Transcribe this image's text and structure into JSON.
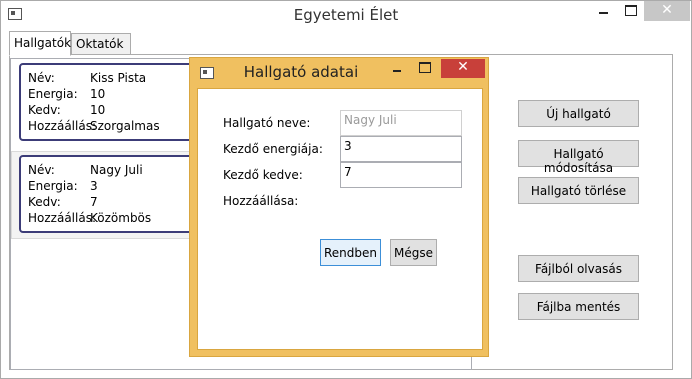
{
  "window": {
    "title": "Egyetemi Élet",
    "close_glyph": "✕"
  },
  "tabs": [
    {
      "label": "Hallgatók",
      "active": true
    },
    {
      "label": "Oktatók",
      "active": false
    }
  ],
  "students": [
    {
      "fields": [
        {
          "label": "Név:",
          "value": "Kiss Pista"
        },
        {
          "label": "Energia:",
          "value": "10"
        },
        {
          "label": "Kedv:",
          "value": "10"
        },
        {
          "label": "Hozzáállás:",
          "value": "Szorgalmas"
        }
      ]
    },
    {
      "fields": [
        {
          "label": "Név:",
          "value": "Nagy Juli"
        },
        {
          "label": "Energia:",
          "value": "3"
        },
        {
          "label": "Kedv:",
          "value": "7"
        },
        {
          "label": "Hozzáállás:",
          "value": "Közömbös"
        }
      ]
    }
  ],
  "side_buttons": {
    "new": "Új hallgató",
    "modify": "Hallgató módosítása",
    "delete": "Hallgató törlése",
    "load": "Fájlból olvasás",
    "save": "Fájlba mentés"
  },
  "dialog": {
    "title": "Hallgató adatai",
    "close_glyph": "✕",
    "name_label": "Hallgató neve:",
    "name_value": "Nagy Juli",
    "energy_label": "Kezdő energiája:",
    "energy_value": "3",
    "mood_label": "Kezdő kedve:",
    "mood_value": "7",
    "attitude_label": "Hozzáállása:",
    "ok_label": "Rendben",
    "cancel_label": "Mégse"
  },
  "colors": {
    "dialog_frame": "#f0c060",
    "dialog_close": "#c8403a",
    "item_border": "#3c3c78"
  }
}
